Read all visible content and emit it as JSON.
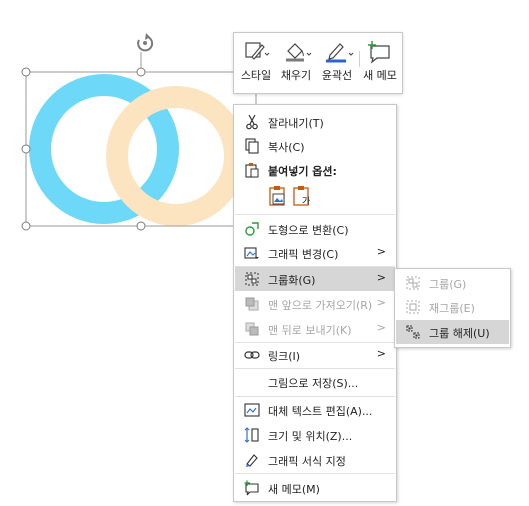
{
  "mini_toolbar": {
    "style_label": "스타일",
    "fill_label": "채우기",
    "outline_label": "윤곽선",
    "comment_label": "새 메모"
  },
  "context_menu": {
    "cut": "잘라내기(T)",
    "copy": "복사(C)",
    "paste_options": "붙여넣기 옵션:",
    "convert_to_shape": "도형으로 변환(C)",
    "change_graphic": "그래픽 변경(C)",
    "group": "그룹화(G)",
    "bring_to_front": "맨 앞으로 가져오기(R)",
    "send_to_back": "맨 뒤로 보내기(K)",
    "link": "링크(I)",
    "save_as_picture": "그림으로 저장(S)...",
    "alt_text": "대체 텍스트 편집(A)...",
    "size_position": "크기 및 위치(Z)...",
    "format_graphic": "그래픽 서식 지정",
    "new_comment": "새 메모(M)"
  },
  "submenu": {
    "group": "그룹(G)",
    "regroup": "재그룹(E)",
    "ungroup": "그룹 해제(U)"
  },
  "colors": {
    "ring_left": "#6dd8f8",
    "ring_right": "#fde4c0",
    "highlight": "#d6d6d6",
    "accent_orange": "#c55a11"
  }
}
